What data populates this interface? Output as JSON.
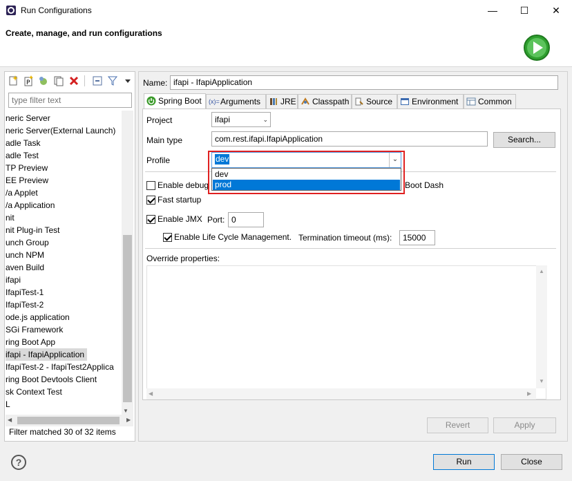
{
  "window": {
    "title": "Run Configurations",
    "header_title": "Create, manage, and run configurations",
    "minimize": "—",
    "maximize": "☐",
    "close": "✕"
  },
  "left": {
    "filter_placeholder": "type filter text",
    "tree": [
      "neric Server",
      "neric Server(External Launch)",
      "adle Task",
      "adle Test",
      "TP Preview",
      "EE Preview",
      "/a Applet",
      "/a Application",
      "nit",
      "nit Plug-in Test",
      "unch Group",
      "unch NPM",
      "aven Build",
      "ifapi",
      "IfapiTest-1",
      "IfapiTest-2",
      "ode.js application",
      "SGi Framework",
      "ring Boot App",
      "ifapi - IfapiApplication",
      "IfapiTest-2 - IfapiTest2Applica",
      "ring Boot Devtools Client",
      "sk Context Test",
      "L"
    ],
    "selected_index": 19,
    "filter_message": "Filter matched 30 of 32 items"
  },
  "right": {
    "name_label": "Name:",
    "name_value": "ifapi - IfapiApplication",
    "tabs": [
      "Spring Boot",
      "Arguments",
      "JRE",
      "Classpath",
      "Source",
      "Environment",
      "Common"
    ],
    "project_label": "Project",
    "project_value": "ifapi",
    "main_type_label": "Main type",
    "main_type_value": "com.rest.ifapi.IfapiApplication",
    "search_button": "Search...",
    "profile_label": "Profile",
    "profile_value": "dev",
    "profile_options": [
      "dev",
      "prod"
    ],
    "profile_highlighted": "prod",
    "enable_debug_label": "Enable debug o",
    "boot_dash_suffix": "Boot Dash",
    "fast_startup_label": "Fast startup",
    "enable_jmx_label": "Enable JMX",
    "port_label": "Port:",
    "port_value": "0",
    "lifecycle_label": "Enable Life Cycle Management.",
    "termination_label": "Termination timeout (ms):",
    "termination_value": "15000",
    "override_label": "Override properties:",
    "revert_button": "Revert",
    "apply_button": "Apply"
  },
  "footer": {
    "help": "?",
    "run_button": "Run",
    "close_button": "Close"
  },
  "colors": {
    "selection": "#0078d7",
    "highlight_frame": "#e02020",
    "run_green": "#2fa02f"
  }
}
